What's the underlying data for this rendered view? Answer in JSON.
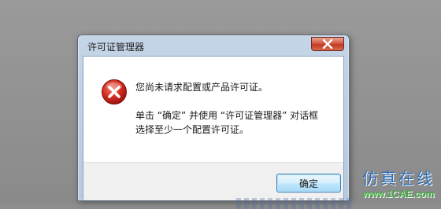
{
  "dialog": {
    "title": "许可证管理器",
    "close_icon": "close-icon",
    "message_primary": "您尚未请求配置或产品许可证。",
    "message_line2": "单击 “确定” 并使用 “许可证管理器” 对话框",
    "message_line3": "选择至少一个配置许可证。",
    "error_icon": "error-icon",
    "ok_label": "确定"
  },
  "watermark": {
    "site_name": "仿真在线",
    "site_url": "www.1CAE.com"
  },
  "colors": {
    "error_red": "#d22a1f",
    "title_bar": "#c5d5e8",
    "close_button": "#c23a21",
    "ok_button": "#bee6fd"
  }
}
